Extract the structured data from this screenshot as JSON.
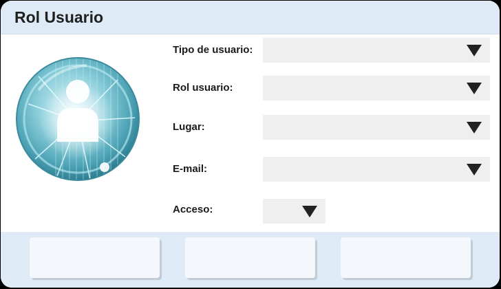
{
  "window": {
    "title": "Rol Usuario"
  },
  "avatar": {
    "icon": "user-avatar-icon"
  },
  "form": {
    "fields": [
      {
        "label": "Tipo de usuario:",
        "value": ""
      },
      {
        "label": "Rol usuario:",
        "value": ""
      },
      {
        "label": "Lugar:",
        "value": ""
      },
      {
        "label": "E-mail:",
        "value": ""
      },
      {
        "label": "Acceso:",
        "value": ""
      }
    ]
  },
  "footer": {
    "buttons": [
      {
        "label": ""
      },
      {
        "label": ""
      },
      {
        "label": ""
      }
    ]
  },
  "colors": {
    "title_bar": "#deebf6",
    "select_bg": "#efefef",
    "footer_bg": "#deebf6",
    "button_bg": "#f4f8fd"
  }
}
